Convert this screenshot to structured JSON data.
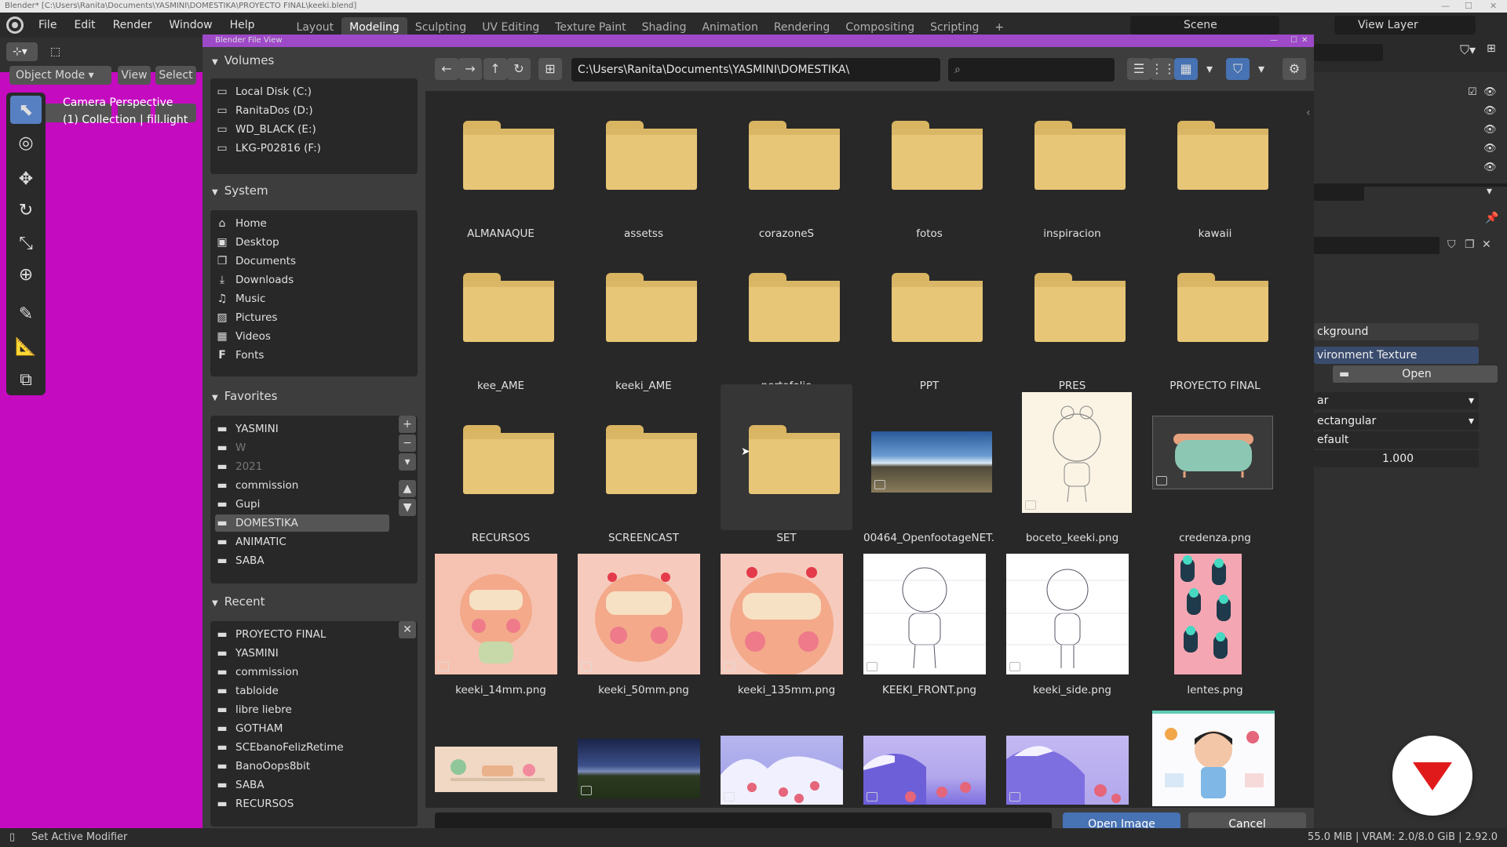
{
  "window_title": "Blender* [C:\\Users\\Ranita\\Documents\\YASMINI\\DOMESTIKA\\PROYECTO FINAL\\keeki.blend]",
  "menu": [
    "File",
    "Edit",
    "Render",
    "Window",
    "Help"
  ],
  "workspaces": [
    "Layout",
    "Modeling",
    "Sculpting",
    "UV Editing",
    "Texture Paint",
    "Shading",
    "Animation",
    "Rendering",
    "Compositing",
    "Scripting"
  ],
  "active_workspace": "Modeling",
  "scene": "Scene",
  "view_layer": "View Layer",
  "viewport": {
    "mode": "Object Mode",
    "view": "View",
    "select": "Select",
    "perspective": "Camera Perspective",
    "collection": "(1) Collection | fill.light",
    "bg_color": "#c40bc0"
  },
  "file_browser": {
    "title": "Blender File View",
    "path": "C:\\Users\\Ranita\\Documents\\YASMINI\\DOMESTIKA\\",
    "search_placeholder": "",
    "volumes": {
      "header": "Volumes",
      "items": [
        "Local Disk (C:)",
        "RanitaDos (D:)",
        "WD_BLACK (E:)",
        "LKG-P02816 (F:)"
      ]
    },
    "system": {
      "header": "System",
      "items": [
        "Home",
        "Desktop",
        "Documents",
        "Downloads",
        "Music",
        "Pictures",
        "Videos",
        "Fonts"
      ]
    },
    "favorites": {
      "header": "Favorites",
      "items": [
        "YASMINI",
        "W",
        "2021",
        "commission",
        "Gupi",
        "DOMESTIKA",
        "ANIMATIC",
        "SABA"
      ],
      "selected": "DOMESTIKA"
    },
    "recent": {
      "header": "Recent",
      "items": [
        "PROYECTO FINAL",
        "YASMINI",
        "commission",
        "tabloide",
        "libre liebre",
        "GOTHAM",
        "SCEbanoFelizRetime",
        "BanoOops8bit",
        "SABA",
        "RECURSOS"
      ]
    },
    "files": [
      "ALMANAQUE",
      "assetss",
      "corazoneS",
      "fotos",
      "inspiracion",
      "kawaii",
      "kee_AME",
      "keeki_AME",
      "portafolio",
      "PPT",
      "PRES",
      "PROYECTO FINAL",
      "RECURSOS",
      "SCREENCAST",
      "SET",
      "00464_OpenfootageNET...",
      "boceto_keeki.png",
      "credenza.png",
      "keeki_14mm.png",
      "keeki_50mm.png",
      "keeki_135mm.png",
      "KEEKI_FRONT.png",
      "keeki_side.png",
      "lentes.png"
    ],
    "open_label": "Open Image",
    "cancel_label": "Cancel"
  },
  "properties": {
    "background": "ckground",
    "env_texture": "vironment Texture",
    "open": "Open",
    "interp": "ar",
    "projection": "ectangular",
    "extension": "efault",
    "strength": "1.000"
  },
  "status": {
    "left": "Set Active Modifier",
    "right": "55.0 MiB | VRAM: 2.0/8.0 GiB | 2.92.0"
  }
}
